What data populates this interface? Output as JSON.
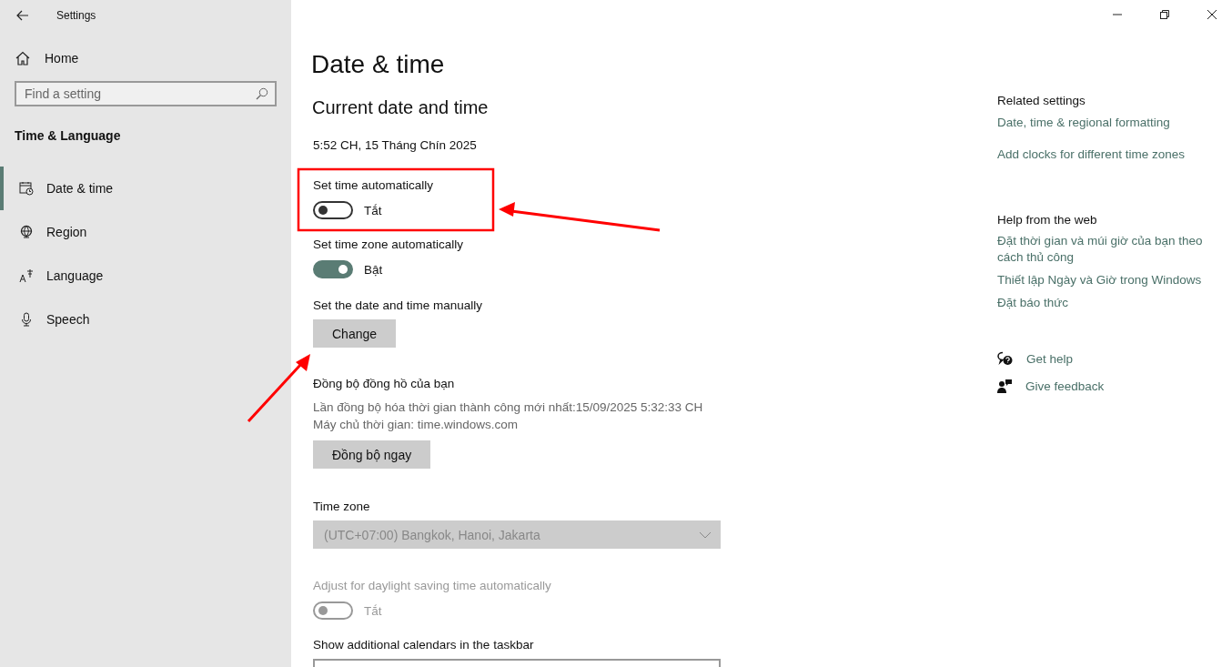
{
  "window": {
    "title": "Settings"
  },
  "sidebar": {
    "home": "Home",
    "search": {
      "placeholder": "Find a setting"
    },
    "section_title": "Time & Language",
    "items": [
      {
        "label": "Date & time",
        "selected": true
      },
      {
        "label": "Region",
        "selected": false
      },
      {
        "label": "Language",
        "selected": false
      },
      {
        "label": "Speech",
        "selected": false
      }
    ]
  },
  "main": {
    "title": "Date & time",
    "subtitle": "Current date and time",
    "current_datetime": "5:52 CH, 15 Tháng Chín 2025",
    "settings": [
      {
        "kind": "toggle",
        "label": "Set time automatically",
        "on": false,
        "state_text": "Tắt",
        "disabled": false
      },
      {
        "kind": "toggle",
        "label": "Set time zone automatically",
        "on": true,
        "state_text": "Bật",
        "disabled": false
      },
      {
        "kind": "button",
        "label": "Set the date and time manually",
        "button": "Change"
      },
      {
        "kind": "sync",
        "label": "Đồng bộ đồng hồ của bạn",
        "lines": [
          "Lần đồng bộ hóa thời gian thành công mới nhất:15/09/2025 5:32:33 CH",
          "Máy chủ thời gian: time.windows.com"
        ],
        "button": "Đồng bộ ngay"
      },
      {
        "kind": "dropdown",
        "label": "Time zone",
        "value": "(UTC+07:00) Bangkok, Hanoi, Jakarta",
        "disabled": true
      },
      {
        "kind": "toggle",
        "label": "Adjust for daylight saving time automatically",
        "on": false,
        "state_text": "Tắt",
        "disabled": true
      },
      {
        "kind": "dropdown",
        "label": "Show additional calendars in the taskbar",
        "disabled": false
      }
    ]
  },
  "related": {
    "heading": "Related settings",
    "links": [
      "Date, time & regional formatting",
      "Add clocks for different time zones"
    ]
  },
  "help": {
    "heading": "Help from the web",
    "links": [
      "Đặt thời gian và múi giờ của bạn theo cách thủ công",
      "Thiết lập Ngày và Giờ trong Windows",
      "Đặt báo thức"
    ]
  },
  "actions": [
    {
      "kind": "help",
      "label": "Get help"
    },
    {
      "kind": "feedback",
      "label": "Give feedback"
    }
  ]
}
